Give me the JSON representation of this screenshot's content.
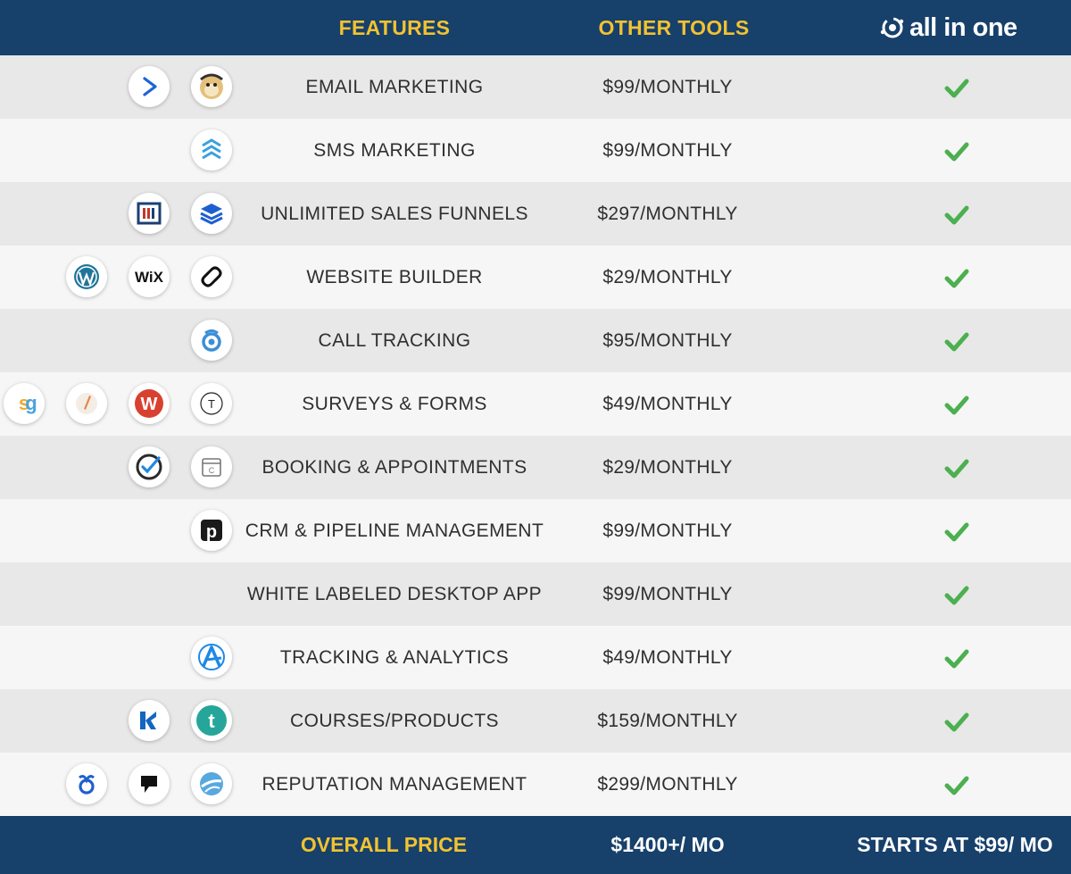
{
  "header": {
    "features_label": "FEATURES",
    "other_tools_label": "OTHER TOOLS",
    "brand_name": "all in one"
  },
  "colors": {
    "header_bg": "#17406b",
    "accent_gold": "#f2c230",
    "check_green": "#4caf50",
    "row_odd": "#e8e8e8",
    "row_even": "#f6f6f6"
  },
  "rows": [
    {
      "feature": "EMAIL MARKETING",
      "price": "$99/MONTHLY",
      "included": true,
      "logos": [
        "activecampaign-icon",
        "mailchimp-icon"
      ]
    },
    {
      "feature": "SMS MARKETING",
      "price": "$99/MONTHLY",
      "included": true,
      "logos": [
        "stacked-chevrons-icon"
      ]
    },
    {
      "feature": "UNLIMITED SALES FUNNELS",
      "price": "$297/MONTHLY",
      "included": true,
      "logos": [
        "clickfunnels-icon",
        "layers-icon"
      ]
    },
    {
      "feature": "WEBSITE BUILDER",
      "price": "$29/MONTHLY",
      "included": true,
      "logos": [
        "wordpress-icon",
        "wix-icon",
        "squarespace-icon"
      ]
    },
    {
      "feature": "CALL TRACKING",
      "price": "$95/MONTHLY",
      "included": true,
      "logos": [
        "call-tracking-icon"
      ]
    },
    {
      "feature": "SURVEYS & FORMS",
      "price": "$49/MONTHLY",
      "included": true,
      "logos": [
        "surveygizmo-icon",
        "pencil-icon",
        "wufoo-icon",
        "typeform-icon"
      ]
    },
    {
      "feature": "BOOKING & APPOINTMENTS",
      "price": "$29/MONTHLY",
      "included": true,
      "logos": [
        "check-circle-icon",
        "calendar-icon"
      ]
    },
    {
      "feature": "CRM & PIPELINE MANAGEMENT",
      "price": "$99/MONTHLY",
      "included": true,
      "logos": [
        "pipedrive-icon"
      ]
    },
    {
      "feature": "WHITE LABELED DESKTOP APP",
      "price": "$99/MONTHLY",
      "included": true,
      "logos": []
    },
    {
      "feature": "TRACKING & ANALYTICS",
      "price": "$49/MONTHLY",
      "included": true,
      "logos": [
        "analytics-a-icon"
      ]
    },
    {
      "feature": "COURSES/PRODUCTS",
      "price": "$159/MONTHLY",
      "included": true,
      "logos": [
        "kajabi-icon",
        "teachable-icon"
      ]
    },
    {
      "feature": "REPUTATION MANAGEMENT",
      "price": "$299/MONTHLY",
      "included": true,
      "logos": [
        "birdeye-icon",
        "podium-icon",
        "reputation-swirl-icon"
      ]
    }
  ],
  "footer": {
    "overall_label": "OVERALL PRICE",
    "other_total": "$1400+/ MO",
    "allinone_price": "STARTS AT $99/ MO"
  }
}
